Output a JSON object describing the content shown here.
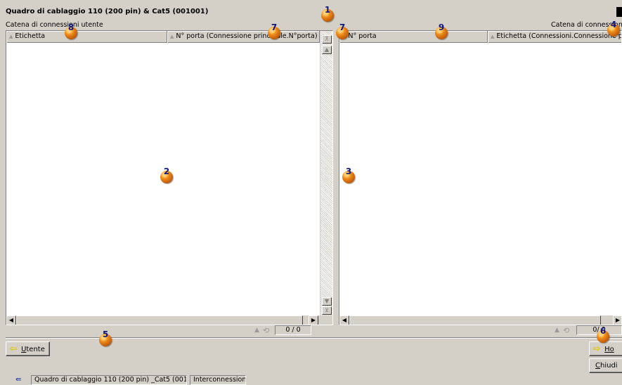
{
  "window": {
    "title": "Quadro di cablaggio 110 (200 pin) & Cat5 (001001)"
  },
  "left_panel": {
    "caption": "Catena di connessioni utente",
    "columns": [
      {
        "label": "Etichetta"
      },
      {
        "label": "N° porta (Connessione principale.N°porta)"
      }
    ],
    "rows": [],
    "counter": "0 / 0"
  },
  "right_panel": {
    "caption": "Catena di connessioni h",
    "columns": [
      {
        "label": "N° porta"
      },
      {
        "label": "Etichetta (Connessioni.Connessione principale)"
      }
    ],
    "rows": [],
    "counter": "0/ 0"
  },
  "buttons": {
    "utente": {
      "icon": "yellow-arrow-left-icon",
      "underlined": "U",
      "rest": "tente"
    },
    "host": {
      "icon": "yellow-arrow-right-icon",
      "underlined": "Ho",
      "rest": ""
    },
    "chiudi": {
      "underlined": "C",
      "rest": "hiudi"
    }
  },
  "statusbar": {
    "icon": "connection-icon",
    "item": "Quadro di cablaggio 110 (200 pin) _Cat5 (001001)",
    "view": "Interconnessioni"
  },
  "callouts": [
    "1",
    "2",
    "3",
    "4",
    "5",
    "6",
    "7",
    "7",
    "8",
    "9"
  ],
  "colors": {
    "window_bg": "#d4d0c8",
    "pane_bg": "#ffffff",
    "callout_orange": "#f08c18",
    "callout_text": "#101a80",
    "arrow_yellow": "#e8d000"
  }
}
